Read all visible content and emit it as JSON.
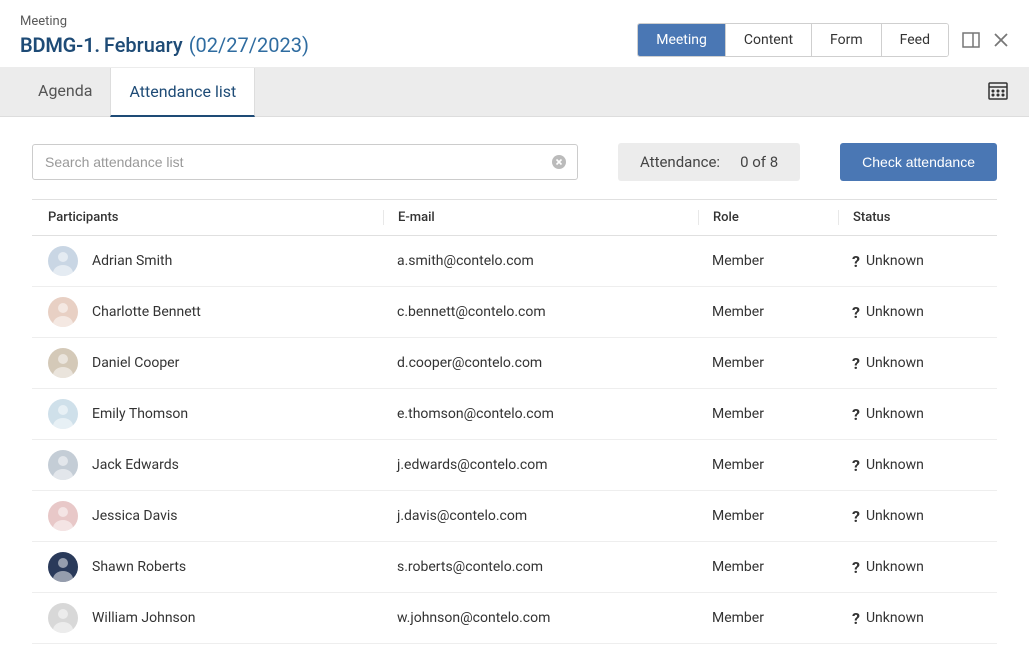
{
  "breadcrumb": "Meeting",
  "title": {
    "id": "BDMG-1.",
    "name": "February",
    "date": "(02/27/2023)"
  },
  "view_tabs": {
    "meeting": "Meeting",
    "content": "Content",
    "form": "Form",
    "feed": "Feed"
  },
  "sub_tabs": {
    "agenda": "Agenda",
    "attendance": "Attendance list"
  },
  "search": {
    "placeholder": "Search attendance list"
  },
  "attendance_summary": {
    "label": "Attendance:",
    "value": "0 of 8"
  },
  "buttons": {
    "check": "Check attendance"
  },
  "table": {
    "headers": {
      "participants": "Participants",
      "email": "E-mail",
      "role": "Role",
      "status": "Status"
    },
    "rows": [
      {
        "name": "Adrian Smith",
        "email": "a.smith@contelo.com",
        "role": "Member",
        "status": "Unknown",
        "avatar_bg": "#c9d6e4"
      },
      {
        "name": "Charlotte Bennett",
        "email": "c.bennett@contelo.com",
        "role": "Member",
        "status": "Unknown",
        "avatar_bg": "#e8d0c4"
      },
      {
        "name": "Daniel Cooper",
        "email": "d.cooper@contelo.com",
        "role": "Member",
        "status": "Unknown",
        "avatar_bg": "#d4c9b8"
      },
      {
        "name": "Emily Thomson",
        "email": "e.thomson@contelo.com",
        "role": "Member",
        "status": "Unknown",
        "avatar_bg": "#cfe0ea"
      },
      {
        "name": "Jack Edwards",
        "email": "j.edwards@contelo.com",
        "role": "Member",
        "status": "Unknown",
        "avatar_bg": "#c4cdd6"
      },
      {
        "name": "Jessica Davis",
        "email": "j.davis@contelo.com",
        "role": "Member",
        "status": "Unknown",
        "avatar_bg": "#e8c8c8"
      },
      {
        "name": "Shawn Roberts",
        "email": "s.roberts@contelo.com",
        "role": "Member",
        "status": "Unknown",
        "avatar_bg": "#2a3a5a"
      },
      {
        "name": "William Johnson",
        "email": "w.johnson@contelo.com",
        "role": "Member",
        "status": "Unknown",
        "avatar_bg": "#d8d8d8"
      }
    ]
  }
}
